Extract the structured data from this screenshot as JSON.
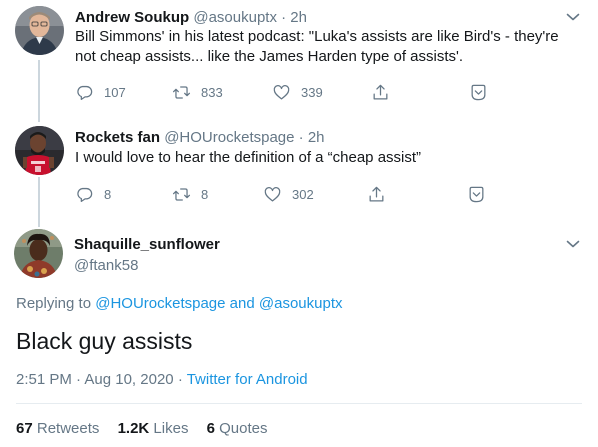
{
  "tweets": [
    {
      "name": "Andrew Soukup",
      "handle": "@asoukuptx",
      "time": "2h",
      "text": "Bill Simmons' in his latest podcast: \"Luka's assists are like Bird's - they're not cheap assists... like the James Harden type of assists'.",
      "replies": "107",
      "retweets": "833",
      "likes": "339"
    },
    {
      "name": "Rockets fan",
      "handle": "@HOUrocketspage",
      "time": "2h",
      "text": "I would love to hear the definition of a “cheap assist”",
      "replies": "8",
      "retweets": "8",
      "likes": "302"
    }
  ],
  "main": {
    "name": "Shaquille_sunflower",
    "handle": "@ftank58",
    "replying_prefix": "Replying to",
    "replying_user1": "@HOUrocketspage",
    "replying_and": "and",
    "replying_user2": "@asoukuptx",
    "text": "Black guy assists",
    "time": "2:51 PM",
    "date": "Aug 10, 2020",
    "source": "Twitter for Android",
    "retweets_count": "67",
    "retweets_label": "Retweets",
    "likes_count": "1.2K",
    "likes_label": "Likes",
    "quotes_count": "6",
    "quotes_label": "Quotes"
  },
  "separator": "·",
  "colors": {
    "text": "#14171a",
    "secondary": "#657786",
    "link": "#1b95e0",
    "thread_line": "#ccd6dd"
  },
  "icons": [
    "reply-icon",
    "retweet-icon",
    "like-icon",
    "share-icon",
    "bookmark-icon",
    "chevron-down-icon"
  ]
}
